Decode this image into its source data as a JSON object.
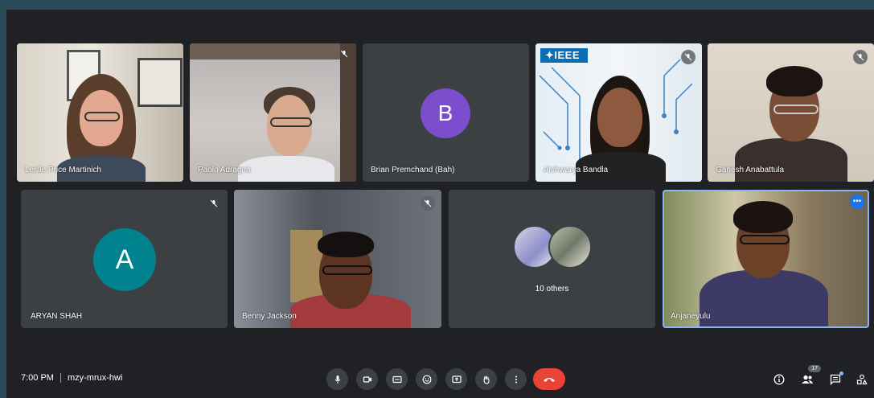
{
  "tiles": [
    {
      "name": "Leslie Price Martinich"
    },
    {
      "name": "Paolo Adragna"
    },
    {
      "name": "Brian Premchand (Bah)",
      "avatar_letter": "B",
      "avatar_color": "#7c4dcc"
    },
    {
      "name": "Aishwarya Bandla",
      "logo": "✦IEEE"
    },
    {
      "name": "Ganesh Anabattula"
    },
    {
      "name": "ARYAN SHAH",
      "avatar_letter": "A",
      "avatar_color": "#00838f"
    },
    {
      "name": "Benny Jackson"
    },
    {
      "name": "",
      "others_label": "10 others"
    },
    {
      "name": "Anjaneyulu",
      "more": "•••"
    }
  ],
  "bottom_bar": {
    "time": "7:00 PM",
    "meeting_code": "mzy-mrux-hwi",
    "controls": [
      "mic-icon",
      "camera-icon",
      "captions-icon",
      "emoji-icon",
      "present-icon",
      "raise-hand-icon",
      "more-options-icon",
      "end-call-icon"
    ],
    "people_count": "17",
    "end_call_color": "#ea4335"
  },
  "colors": {
    "background": "#202124",
    "tile": "#3c4043",
    "accent": "#8ab4f8"
  }
}
